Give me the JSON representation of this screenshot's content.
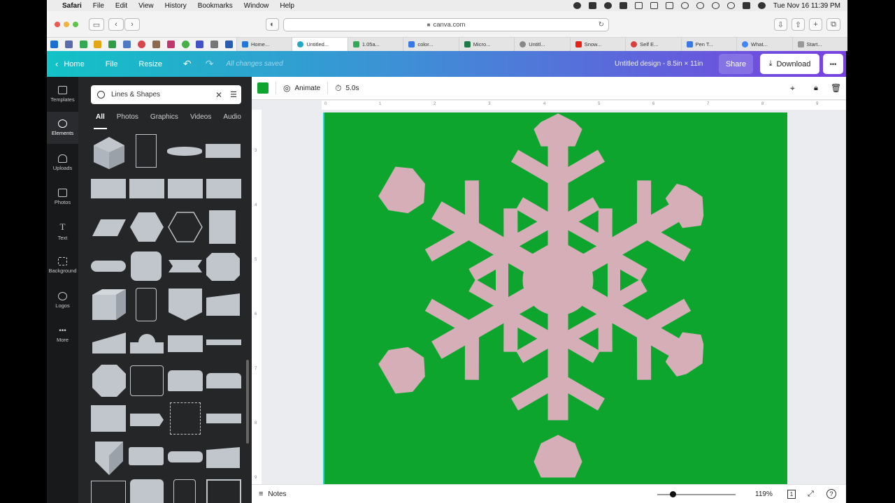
{
  "menubar": {
    "app": "Safari",
    "items": [
      "File",
      "Edit",
      "View",
      "History",
      "Bookmarks",
      "Window",
      "Help"
    ],
    "clock": "Tue Nov 16  11:39 PM"
  },
  "browser": {
    "url": "canva.com",
    "tabs": [
      {
        "label": "Home..."
      },
      {
        "label": "Untitled..."
      },
      {
        "label": "1.05a..."
      },
      {
        "label": "color..."
      },
      {
        "label": "Micro..."
      },
      {
        "label": "Untitl..."
      },
      {
        "label": "Snow..."
      },
      {
        "label": "Self E..."
      },
      {
        "label": "Pen T..."
      },
      {
        "label": "What..."
      },
      {
        "label": "Start..."
      }
    ],
    "active_tab_index": 1
  },
  "header": {
    "home": "Home",
    "file": "File",
    "resize": "Resize",
    "save_status": "All changes saved",
    "design_title": "Untitled design - 8.5in × 11in",
    "share": "Share",
    "download": "Download",
    "more": "•••"
  },
  "rail": [
    {
      "label": "Templates",
      "icon": "templates-icon"
    },
    {
      "label": "Elements",
      "icon": "elements-icon"
    },
    {
      "label": "Uploads",
      "icon": "uploads-icon"
    },
    {
      "label": "Photos",
      "icon": "photos-icon"
    },
    {
      "label": "Text",
      "icon": "text-icon"
    },
    {
      "label": "Background",
      "icon": "background-icon"
    },
    {
      "label": "Logos",
      "icon": "logos-icon"
    },
    {
      "label": "More",
      "icon": "more-icon"
    }
  ],
  "panel": {
    "search_value": "Lines & Shapes",
    "categories": [
      "All",
      "Photos",
      "Graphics",
      "Videos",
      "Audio"
    ]
  },
  "toolbar": {
    "animate": "Animate",
    "duration": "5.0s",
    "swatch_color": "#0ea52e"
  },
  "ruler": {
    "top": [
      "0",
      "1",
      "2",
      "3",
      "4",
      "5",
      "6",
      "7",
      "8",
      "9"
    ],
    "left": [
      "3",
      "4",
      "5",
      "6",
      "7",
      "8",
      "9"
    ]
  },
  "canvas": {
    "background": "#0ea52e",
    "snowflake_color": "#d5aeb7"
  },
  "bottombar": {
    "notes": "Notes",
    "zoom": "119%",
    "zoom_fraction": 0.2
  }
}
